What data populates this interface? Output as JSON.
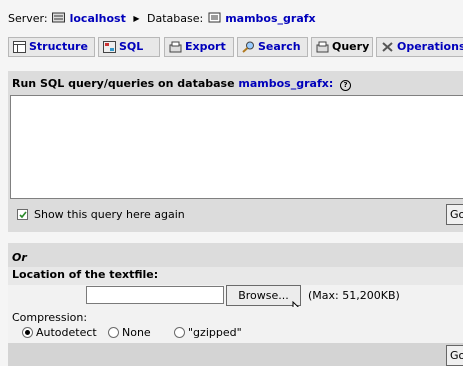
{
  "breadcrumb": {
    "server_label": "Server:",
    "server_name": "localhost",
    "database_label": "Database:",
    "database_name": "mambos_grafx"
  },
  "tabs": [
    {
      "label": "Structure",
      "icon": "structure-icon"
    },
    {
      "label": "SQL",
      "icon": "sql-icon"
    },
    {
      "label": "Export",
      "icon": "export-icon"
    },
    {
      "label": "Search",
      "icon": "search-icon"
    },
    {
      "label": "Query",
      "icon": "query-icon"
    },
    {
      "label": "Operations",
      "icon": "operations-icon"
    }
  ],
  "query_panel": {
    "header_prefix": "Run SQL query/queries on database",
    "database_name": "mambos_grafx:",
    "sql_text": "",
    "show_again_label": "Show this query here again",
    "show_again_checked": true,
    "go_label": "Go"
  },
  "file_panel": {
    "or_label": "Or",
    "location_label": "Location of the textfile:",
    "file_value": "",
    "browse_label": "Browse...",
    "max_label": "(Max: 51,200KB)",
    "compression_label": "Compression:",
    "compression_options": [
      "Autodetect",
      "None",
      "\"gzipped\""
    ],
    "compression_selected": "Autodetect",
    "go_label": "Go"
  }
}
